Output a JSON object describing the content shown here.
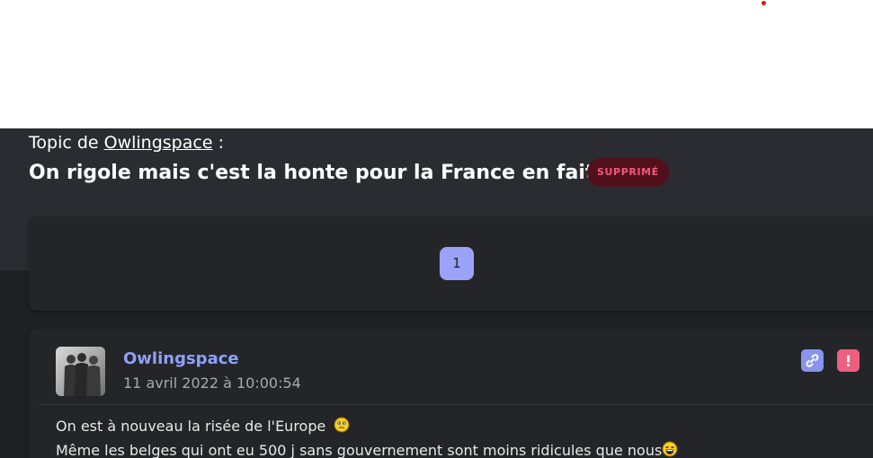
{
  "topic": {
    "prefix": "Topic de",
    "author": "Owlingspace",
    "suffix": " :",
    "title": "On rigole mais c'est la honte pour la France en fait",
    "status_badge": "SUPPRIMÉ"
  },
  "pagination": {
    "pages": [
      "1"
    ],
    "current": "1"
  },
  "post": {
    "author": "Owlingspace",
    "date": "11 avril 2022 à 10:00:54",
    "lines": [
      "On est à nouveau la risée de l'Europe",
      "Même les belges qui ont eu 500 j sans gouvernement sont moins ridicules que nous"
    ],
    "actions": {
      "link_icon": "link-icon",
      "report_icon": "report-icon"
    }
  },
  "colors": {
    "accent": "#9aa3f7",
    "author_link": "#8fa0ff",
    "badge_bg": "#52101d",
    "badge_text": "#f0587a",
    "report": "#ee5e7e",
    "background": "#1f2023",
    "header": "#2b2c31"
  }
}
